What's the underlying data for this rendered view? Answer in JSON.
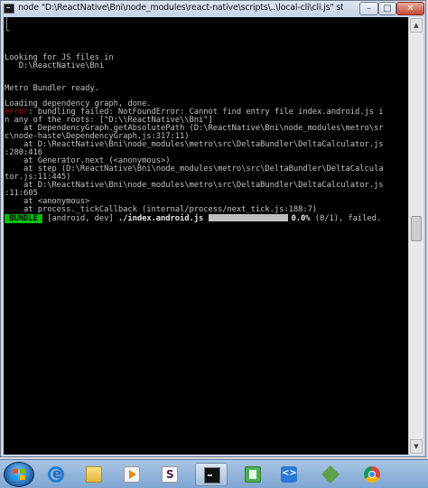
{
  "window": {
    "title": "node  \"D:\\ReactNative\\Bni\\node_modules\\react-native\\scripts\\..\\local-cli\\cli.js\" start",
    "minimize_glyph": "–",
    "maximize_glyph": "□",
    "close_glyph": "✕"
  },
  "console": {
    "lines": {
      "l0": "│",
      "l1": "└",
      "l2": "Looking for JS files in",
      "l3": "   D:\\ReactNative\\Bni",
      "l4": "Metro Bundler ready.",
      "l5": "Loading dependency graph, done.",
      "l6_label": "error",
      "l6_text": ": bundling failed: NotFoundError: Cannot find entry file index.android.js i",
      "l7": "n any of the roots: [\"D:\\\\ReactNative\\\\Bni\"]",
      "l8": "    at DependencyGraph.getAbsolutePath (D:\\ReactNative\\Bni\\node_modules\\metro\\sr",
      "l9": "c\\node-haste\\DependencyGraph.js:317:11)",
      "l10": "    at D:\\ReactNative\\Bni\\node_modules\\metro\\src\\DeltaBundler\\DeltaCalculator.js",
      "l11": ":280:416",
      "l12": "    at Generator.next (<anonymous>)",
      "l13": "    at step (D:\\ReactNative\\Bni\\node_modules\\metro\\src\\DeltaBundler\\DeltaCalcula",
      "l14": "tor.js:11:445)",
      "l15": "    at D:\\ReactNative\\Bni\\node_modules\\metro\\src\\DeltaBundler\\DeltaCalculator.js",
      "l16": ":11:605",
      "l17": "    at <anonymous>",
      "l18": "    at process._tickCallback (internal/process/next_tick.js:188:7)"
    },
    "bundle": {
      "tag": " BUNDLE ",
      "platform": " [android, dev] ",
      "file": "./index.android.js",
      "percent": "0.0%",
      "progress_fraction": 0.0,
      "status": " (0/1), failed."
    }
  },
  "colors": {
    "console_bg": "#000000",
    "console_text": "#c0c0c0",
    "error_label": "#c00000",
    "bundle_tag_bg": "#00c000"
  },
  "taskbar": {
    "items": [
      {
        "icon": "start-orb-icon"
      },
      {
        "icon": "internet-explorer-icon"
      },
      {
        "icon": "folder-icon"
      },
      {
        "icon": "media-player-icon"
      },
      {
        "icon": "slack-icon"
      },
      {
        "icon": "command-prompt-icon",
        "active": true
      },
      {
        "icon": "android-emulator-icon"
      },
      {
        "icon": "vscode-icon"
      },
      {
        "icon": "nodejs-icon"
      },
      {
        "icon": "chrome-icon"
      }
    ]
  }
}
